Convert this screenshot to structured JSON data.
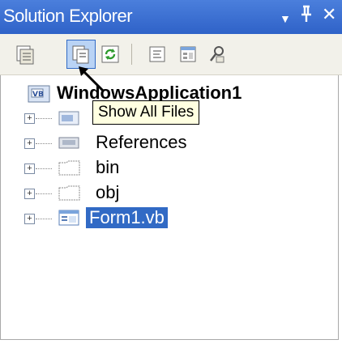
{
  "window": {
    "title": "Solution Explorer",
    "buttons": [
      {
        "name": "dropdown-icon",
        "glyph": "▼"
      },
      {
        "name": "pin-icon",
        "glyph": "ᛘ"
      },
      {
        "name": "close-icon",
        "glyph": "✕"
      }
    ]
  },
  "toolbar": {
    "tools": [
      {
        "name": "properties-icon"
      },
      {
        "name": "show-all-files-icon",
        "active": true
      },
      {
        "name": "refresh-icon"
      },
      {
        "name": "view-code-icon"
      },
      {
        "name": "view-designer-icon"
      },
      {
        "name": "class-view-icon"
      }
    ],
    "tooltip": "Show All Files"
  },
  "tree": {
    "root": {
      "label": "WindowsApplication1",
      "icon": "vb-project-icon"
    },
    "items": [
      {
        "label": "",
        "icon": "my-project-icon"
      },
      {
        "label": "References",
        "icon": "references-icon"
      },
      {
        "label": "bin",
        "icon": "folder-icon"
      },
      {
        "label": "obj",
        "icon": "folder-icon"
      },
      {
        "label": "Form1.vb",
        "icon": "form-icon",
        "selected": true
      }
    ]
  },
  "colors": {
    "title_bar": "#3a6fd6",
    "selection": "#316ac5",
    "tooltip_bg": "#ffffe1",
    "toolbar_bg": "#f2f1ea"
  }
}
